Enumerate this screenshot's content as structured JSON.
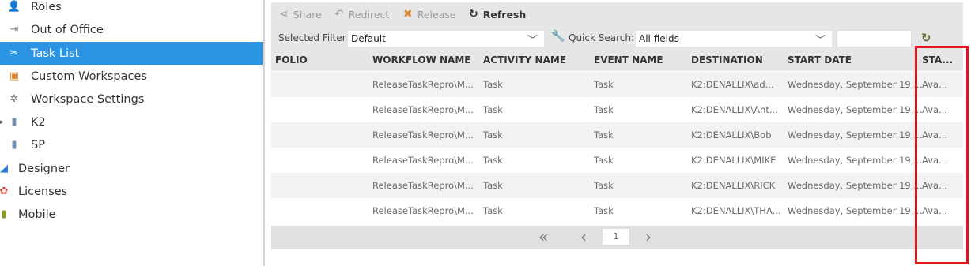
{
  "sidebar": {
    "items": [
      {
        "label": "Roles",
        "icon": "roles-icon",
        "glyph": "👤",
        "color": "#8a7b3a"
      },
      {
        "label": "Out of Office",
        "icon": "out-of-office-icon",
        "glyph": "⇥",
        "color": "#888888"
      },
      {
        "label": "Task List",
        "icon": "task-list-icon",
        "glyph": "✂",
        "color": "#ffffff"
      },
      {
        "label": "Custom Workspaces",
        "icon": "custom-workspaces-icon",
        "glyph": "▣",
        "color": "#e0892a"
      },
      {
        "label": "Workspace Settings",
        "icon": "workspace-settings-icon",
        "glyph": "✲",
        "color": "#777777"
      },
      {
        "label": "K2",
        "icon": "server-icon",
        "glyph": "▮",
        "color": "#6f8fb0"
      },
      {
        "label": "SP",
        "icon": "server-icon",
        "glyph": "▮",
        "color": "#6f8fb0"
      },
      {
        "label": "Designer",
        "icon": "designer-icon",
        "glyph": "◢",
        "color": "#2b7fd8"
      },
      {
        "label": "Licenses",
        "icon": "licenses-icon",
        "glyph": "✿",
        "color": "#d0453a"
      },
      {
        "label": "Mobile",
        "icon": "mobile-icon",
        "glyph": "▮",
        "color": "#8a9a1e"
      }
    ]
  },
  "toolbar": {
    "share_label": "Share",
    "redirect_label": "Redirect",
    "release_label": "Release",
    "refresh_label": "Refresh",
    "selected_filter_label": "Selected Filter:",
    "selected_filter_value": "Default",
    "quick_search_label": "Quick Search:",
    "quick_search_field_value": "All fields",
    "quick_search_text": ""
  },
  "grid": {
    "columns": [
      "FOLIO",
      "WORKFLOW NAME",
      "ACTIVITY NAME",
      "EVENT NAME",
      "DESTINATION",
      "START DATE",
      "STA..."
    ],
    "rows": [
      {
        "folio": "",
        "workflow": "ReleaseTaskRepro\\M...",
        "activity": "Task",
        "event": "Task",
        "destination": "K2:DENALLIX\\ad...",
        "start_date": "Wednesday, September 19,...",
        "status": "Ava..."
      },
      {
        "folio": "",
        "workflow": "ReleaseTaskRepro\\M...",
        "activity": "Task",
        "event": "Task",
        "destination": "K2:DENALLIX\\Ant...",
        "start_date": "Wednesday, September 19,...",
        "status": "Ava..."
      },
      {
        "folio": "",
        "workflow": "ReleaseTaskRepro\\M...",
        "activity": "Task",
        "event": "Task",
        "destination": "K2:DENALLIX\\Bob",
        "start_date": "Wednesday, September 19,...",
        "status": "Ava..."
      },
      {
        "folio": "",
        "workflow": "ReleaseTaskRepro\\M...",
        "activity": "Task",
        "event": "Task",
        "destination": "K2:DENALLIX\\MIKE",
        "start_date": "Wednesday, September 19,...",
        "status": "Ava..."
      },
      {
        "folio": "",
        "workflow": "ReleaseTaskRepro\\M...",
        "activity": "Task",
        "event": "Task",
        "destination": "K2:DENALLIX\\RICK",
        "start_date": "Wednesday, September 19,...",
        "status": "Ava..."
      },
      {
        "folio": "",
        "workflow": "ReleaseTaskRepro\\M...",
        "activity": "Task",
        "event": "Task",
        "destination": "K2:DENALLIX\\THA...",
        "start_date": "Wednesday, September 19,...",
        "status": "Ava..."
      }
    ]
  },
  "pager": {
    "first_glyph": "«",
    "prev_glyph": "‹",
    "page": "1",
    "next_glyph": "›"
  },
  "colors": {
    "accent": "#2b95e3",
    "highlight": "#e3131b"
  }
}
